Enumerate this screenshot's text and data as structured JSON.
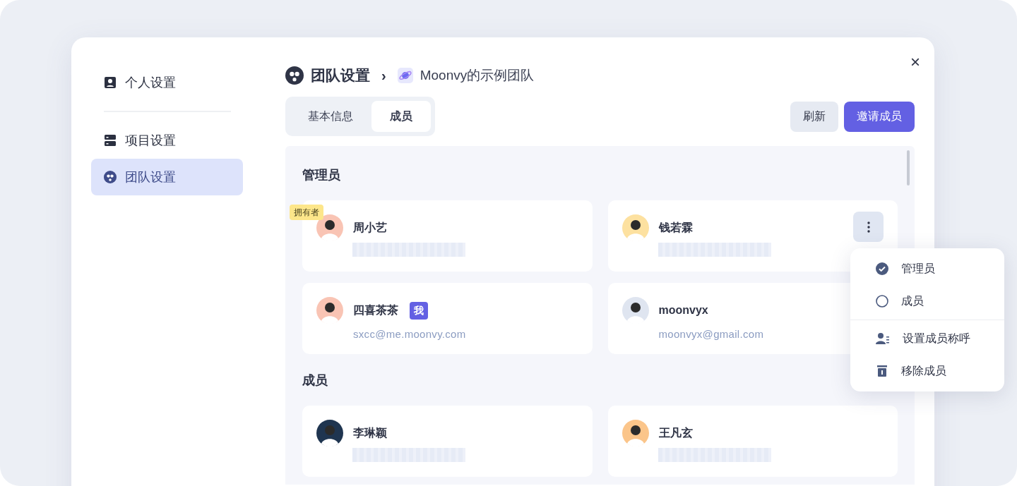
{
  "sidebar": {
    "items": [
      {
        "label": "个人设置",
        "kind": "person",
        "selected": false
      },
      {
        "label": "项目设置",
        "kind": "project",
        "selected": false
      },
      {
        "label": "团队设置",
        "kind": "team",
        "selected": true
      }
    ]
  },
  "breadcrumb": {
    "section": "团队设置",
    "separator": "›",
    "team": "Moonvy的示例团队"
  },
  "close": "×",
  "tabs": [
    {
      "label": "基本信息",
      "selected": false
    },
    {
      "label": "成员",
      "selected": true
    }
  ],
  "buttons": [
    {
      "label": "刷新",
      "kind": "secondary"
    },
    {
      "label": "邀请成员",
      "kind": "primary"
    }
  ],
  "groups": [
    {
      "title": "管理员",
      "members": [
        {
          "name": "周小艺",
          "owner_badge": "拥有者",
          "email_hidden": true,
          "color": "#f9c4b4"
        },
        {
          "name": "钱若霖",
          "email_hidden": true,
          "color": "#fde1a0",
          "menu_open": true
        },
        {
          "name": "四喜茶茶",
          "me_badge": "我",
          "email": "sxcc@me.moonvy.com",
          "color": "#f9c4b4"
        },
        {
          "name": "moonvyx",
          "email": "moonvyx@gmail.com",
          "color": "#dfe5f0"
        }
      ]
    },
    {
      "title": "成员",
      "members": [
        {
          "name": "李琳颖",
          "email_hidden": true,
          "color": "#1f3550"
        },
        {
          "name": "王凡玄",
          "email_hidden": true,
          "color": "#fbc58a"
        }
      ]
    }
  ],
  "menu": [
    {
      "label": "管理员",
      "kind": "radio",
      "selected": true
    },
    {
      "label": "成员",
      "kind": "radio",
      "selected": false
    },
    {
      "label": "设置成员称呼",
      "kind": "nickname"
    },
    {
      "label": "移除成员",
      "kind": "delete"
    }
  ]
}
